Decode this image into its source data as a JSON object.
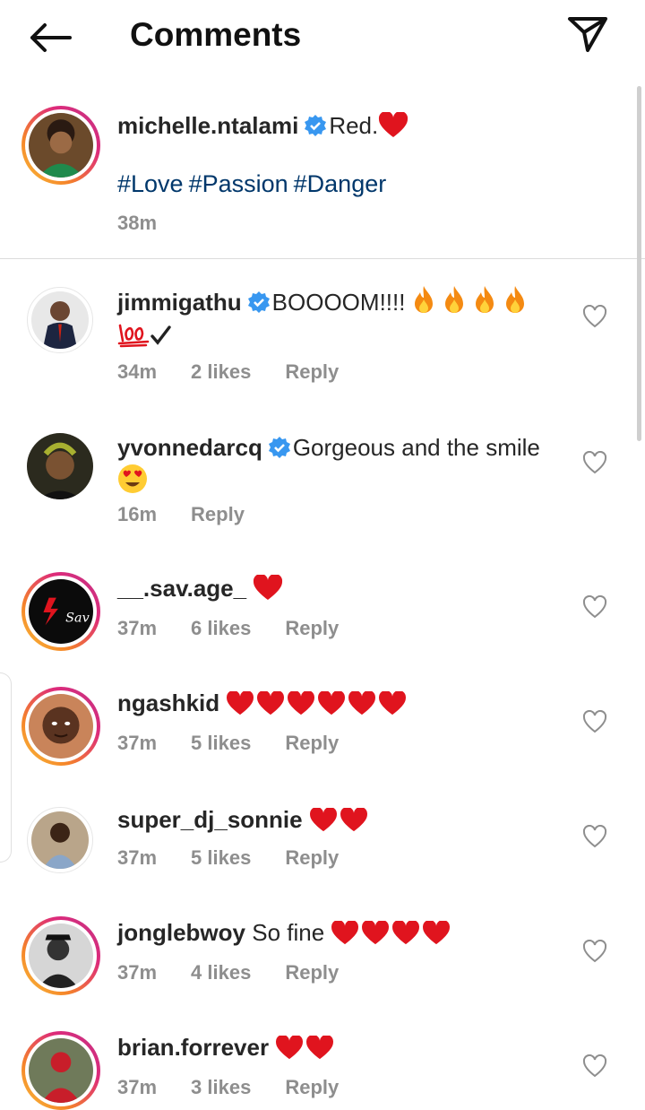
{
  "header": {
    "title": "Comments"
  },
  "caption": {
    "username": "michelle.ntalami",
    "text": "Red.",
    "hashtags": [
      "#Love",
      "#Passion",
      "#Danger"
    ],
    "time": "38m"
  },
  "comments": [
    {
      "username": "jimmigathu",
      "text": "BOOOOM!!!!",
      "time": "34m",
      "likes": "2 likes",
      "reply": "Reply"
    },
    {
      "username": "yvonnedarcq",
      "text": "Gorgeous and the smile",
      "time": "16m",
      "likes": "",
      "reply": "Reply"
    },
    {
      "username": "__.sav.age_",
      "text": "",
      "time": "37m",
      "likes": "6 likes",
      "reply": "Reply"
    },
    {
      "username": "ngashkid",
      "text": "",
      "time": "37m",
      "likes": "5 likes",
      "reply": "Reply"
    },
    {
      "username": "super_dj_sonnie",
      "text": "",
      "time": "37m",
      "likes": "5 likes",
      "reply": "Reply"
    },
    {
      "username": "jonglebwoy",
      "text": "So fine",
      "time": "37m",
      "likes": "4 likes",
      "reply": "Reply"
    },
    {
      "username": "brian.forrever",
      "text": "",
      "time": "37m",
      "likes": "3 likes",
      "reply": "Reply"
    }
  ],
  "colors": {
    "accent_link": "#00376b",
    "verified": "#3897f0",
    "meta": "#8e8e8e",
    "heart": "#e0141e"
  }
}
